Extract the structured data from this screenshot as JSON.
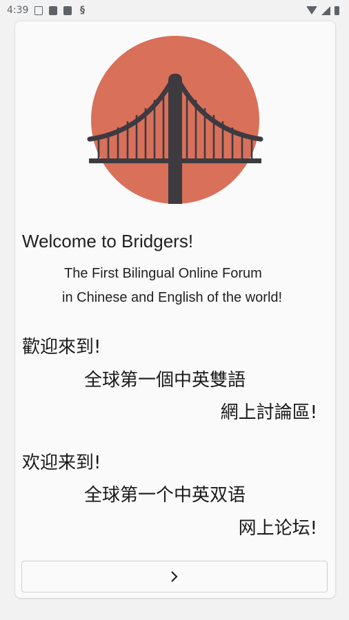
{
  "status_bar": {
    "time": "4:39",
    "left_icons": [
      "edit-note-icon",
      "font-a-icon",
      "sd-card-icon",
      "s-app-icon"
    ],
    "right_icons": [
      "wifi-icon",
      "signal-icon",
      "battery-icon"
    ]
  },
  "welcome": {
    "title": "Welcome to Bridgers!",
    "subtitle_line1": "The First Bilingual Online Forum",
    "subtitle_line2": "in Chinese and English of the world!"
  },
  "traditional": {
    "line1": "歡迎來到!",
    "line2": "全球第一個中英雙語",
    "line3": "網上討論區!"
  },
  "simplified": {
    "line1": "欢迎来到!",
    "line2": "全球第一个中英双语",
    "line3": "网上论坛!"
  },
  "logo": {
    "icon": "bridge-logo-icon",
    "circle_color": "#d9705a",
    "bridge_color": "#3d3a40"
  },
  "next_button": {
    "icon": "chevron-right-icon"
  }
}
